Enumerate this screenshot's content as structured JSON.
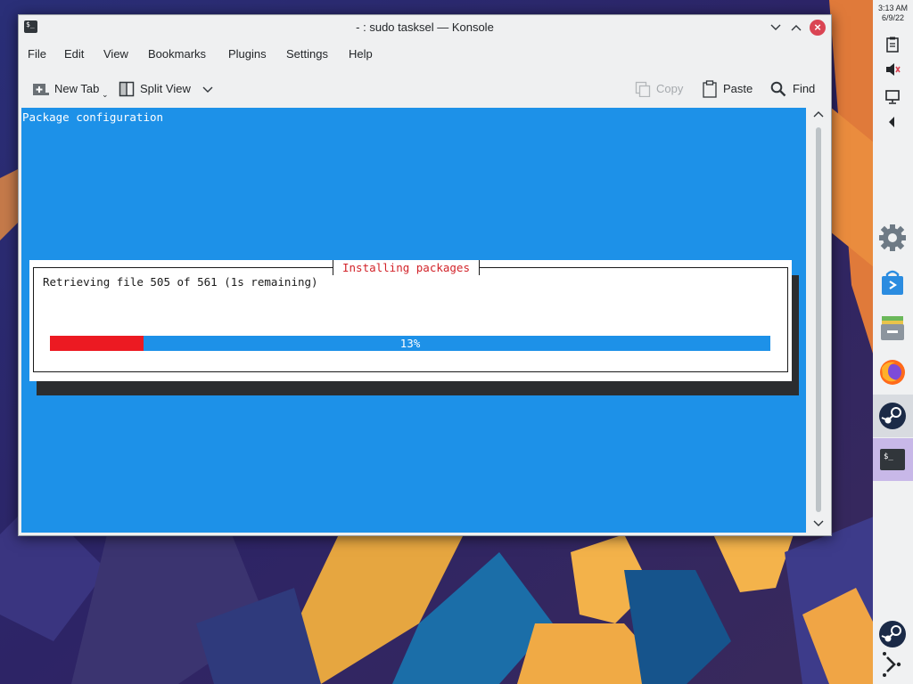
{
  "window": {
    "title": "- : sudo tasksel — Konsole",
    "app_icon": "$_"
  },
  "menubar": [
    "File",
    "Edit",
    "View",
    "Bookmarks",
    "Plugins",
    "Settings",
    "Help"
  ],
  "toolbar": {
    "new_tab": "New Tab",
    "split_view": "Split View",
    "copy": "Copy",
    "paste": "Paste",
    "find": "Find"
  },
  "terminal": {
    "header": "Package configuration",
    "dialog": {
      "title": "Installing packages",
      "message": "Retrieving file 505 of 561 (1s remaining)",
      "progress_label": "13%",
      "progress_fraction": 0.13
    }
  },
  "panel": {
    "time": "3:13 AM",
    "date": "6/9/22",
    "tray_icons": [
      "clipboard-icon",
      "volume-muted-icon",
      "display-icon",
      "expand-arrow-icon"
    ],
    "task_icons": [
      "settings-icon",
      "discover-store-icon",
      "file-manager-icon",
      "firefox-icon",
      "steam-icon",
      "konsole-icon"
    ],
    "bottom_icons": [
      "steam-icon",
      "kde-connect-icon"
    ]
  },
  "colors": {
    "terminal_bg": "#1d91e8",
    "progress_fill": "#ec1a22",
    "dialog_title": "#d2232a",
    "close_button": "#da4453"
  }
}
